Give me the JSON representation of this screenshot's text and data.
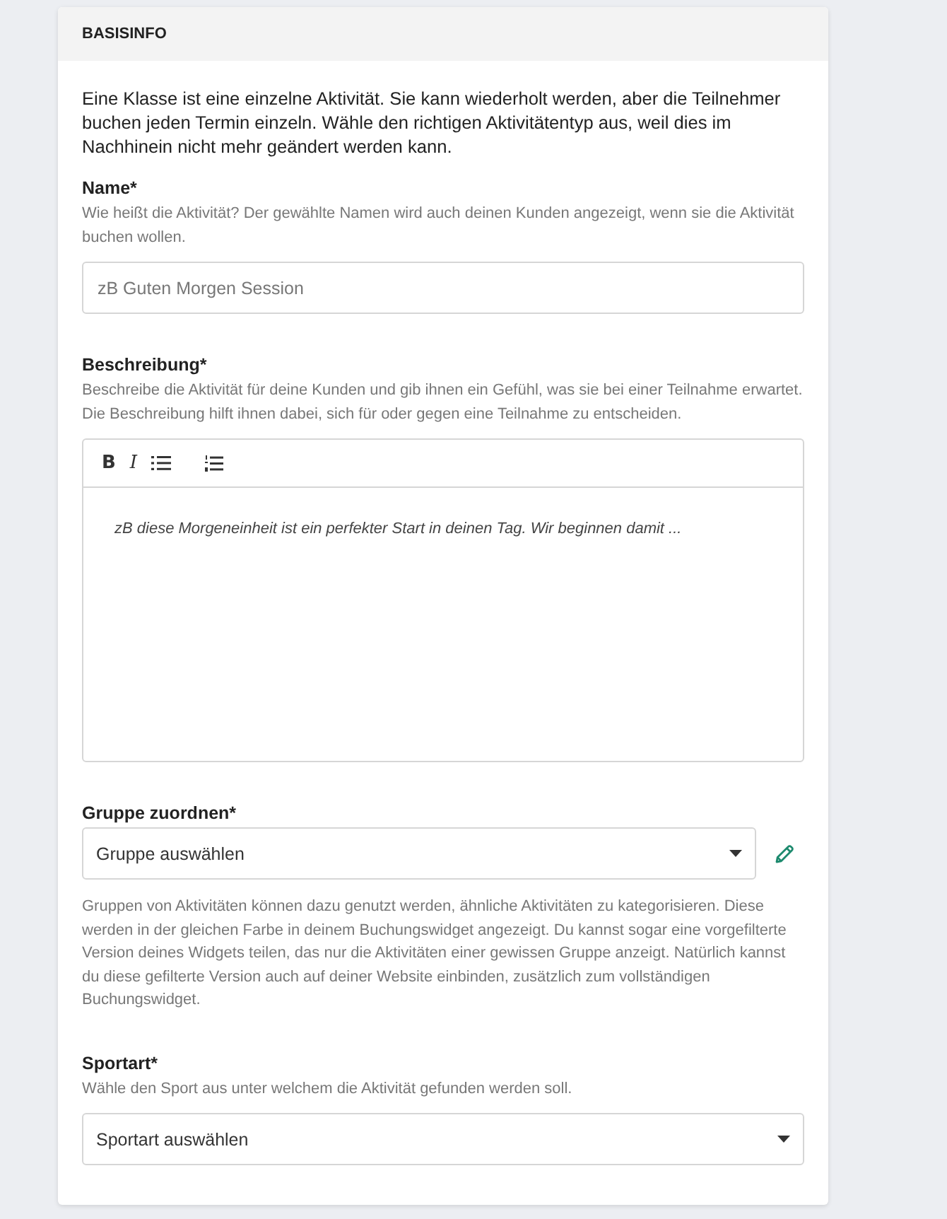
{
  "section": {
    "title": "BASISINFO"
  },
  "intro": "Eine Klasse ist eine einzelne Aktivität. Sie kann wiederholt werden, aber die Teilnehmer buchen jeden Termin einzeln. Wähle den richtigen Aktivitätentyp aus, weil dies im Nachhinein nicht mehr geändert werden kann.",
  "fields": [
    {
      "kind": "text",
      "label": "Name*",
      "help": "Wie heißt die Aktivität? Der gewählte Namen wird auch deinen Kunden angezeigt, wenn sie die Aktivität buchen wollen.",
      "placeholder": "zB Guten Morgen Session"
    },
    {
      "kind": "editor",
      "label": "Beschreibung*",
      "help": "Beschreibe die Aktivität für deine Kunden und gib ihnen ein Gefühl, was sie bei einer Teilnahme erwartet. Die Beschreibung hilft ihnen dabei, sich für oder gegen eine Teilnahme zu entscheiden.",
      "placeholder": "zB diese Morgeneinheit ist ein perfekter Start in deinen Tag. Wir beginnen damit ...",
      "toolbar": [
        {
          "kind": "bold",
          "label": "B"
        },
        {
          "kind": "italic",
          "label": "I"
        },
        {
          "kind": "bullet_list"
        },
        {
          "kind": "numbered_list"
        }
      ]
    },
    {
      "kind": "select",
      "label": "Gruppe zuordnen*",
      "value": "Gruppe auswählen",
      "editable": true,
      "note": "Gruppen von Aktivitäten können dazu genutzt werden, ähnliche Aktivitäten zu kategorisieren. Diese werden in der gleichen Farbe in deinem Buchungswidget angezeigt. Du kannst sogar eine vorgefilterte Version deines Widgets teilen, das nur die Aktivitäten einer gewissen Gruppe anzeigt. Natürlich kannst du diese gefilterte Version auch auf deiner Website einbinden, zusätzlich zum vollständigen Buchungswidget."
    },
    {
      "kind": "select",
      "label": "Sportart*",
      "help": "Wähle den Sport aus unter welchem die Aktivität gefunden werden soll.",
      "value": "Sportart auswählen",
      "editable": false
    }
  ]
}
